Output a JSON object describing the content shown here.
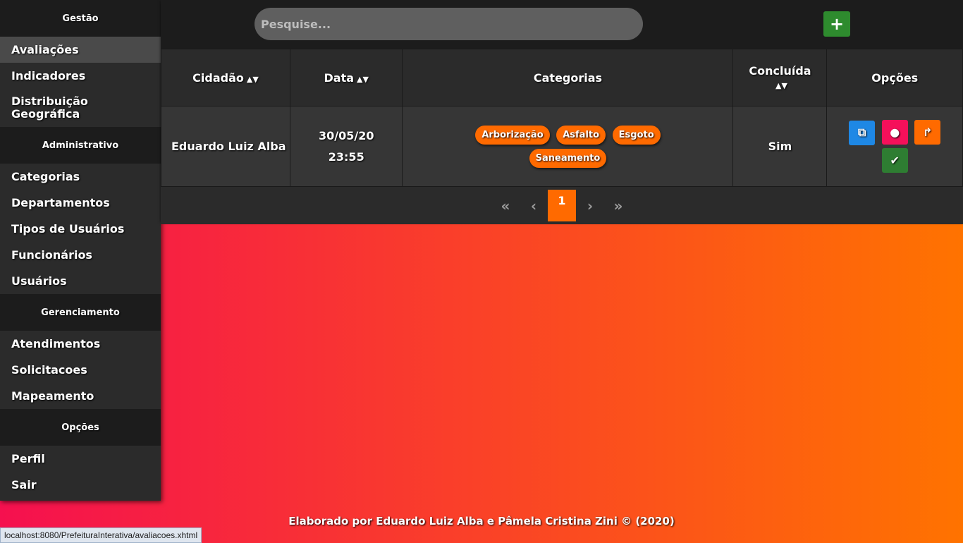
{
  "sidebar": {
    "sections": [
      {
        "title": "Gestão"
      },
      {
        "title": "Administrativo"
      },
      {
        "title": "Gerenciamento"
      },
      {
        "title": "Opções"
      }
    ],
    "gestao": [
      "Avaliações",
      "Indicadores",
      "Distribuição Geográfica"
    ],
    "administrativo": [
      "Categorias",
      "Departamentos",
      "Tipos de Usuários",
      "Funcionários",
      "Usuários"
    ],
    "gerenciamento": [
      "Atendimentos",
      "Solicitacoes",
      "Mapeamento"
    ],
    "opcoes": [
      "Perfil",
      "Sair"
    ]
  },
  "search": {
    "placeholder": "Pesquise..."
  },
  "add_button": {
    "label": "+"
  },
  "table": {
    "headers": [
      "Cidadão",
      "Data",
      "Categorias",
      "Concluída",
      "Opções"
    ],
    "rows": [
      {
        "cidadao": "Eduardo Luiz Alba",
        "data": "30/05/20 23:55",
        "categorias": [
          "Arborização",
          "Asfalto",
          "Esgoto",
          "Saneamento"
        ],
        "concluida": "Sim"
      }
    ]
  },
  "pagination": {
    "first": "«",
    "prev": "‹",
    "current": "1",
    "next": "›",
    "last": "»"
  },
  "footer": "Elaborado por Eduardo Luiz Alba e Pâmela Cristina Zini © (2020)",
  "status_url": "localhost:8080/PrefeituraInterativa/avaliacoes.xhtml",
  "colors": {
    "accent": "#ff6a00",
    "add": "#2e8b2e",
    "open": "#1e88e5",
    "comment": "#f5105a",
    "forward": "#ff6a00",
    "check": "#2e7d32"
  }
}
